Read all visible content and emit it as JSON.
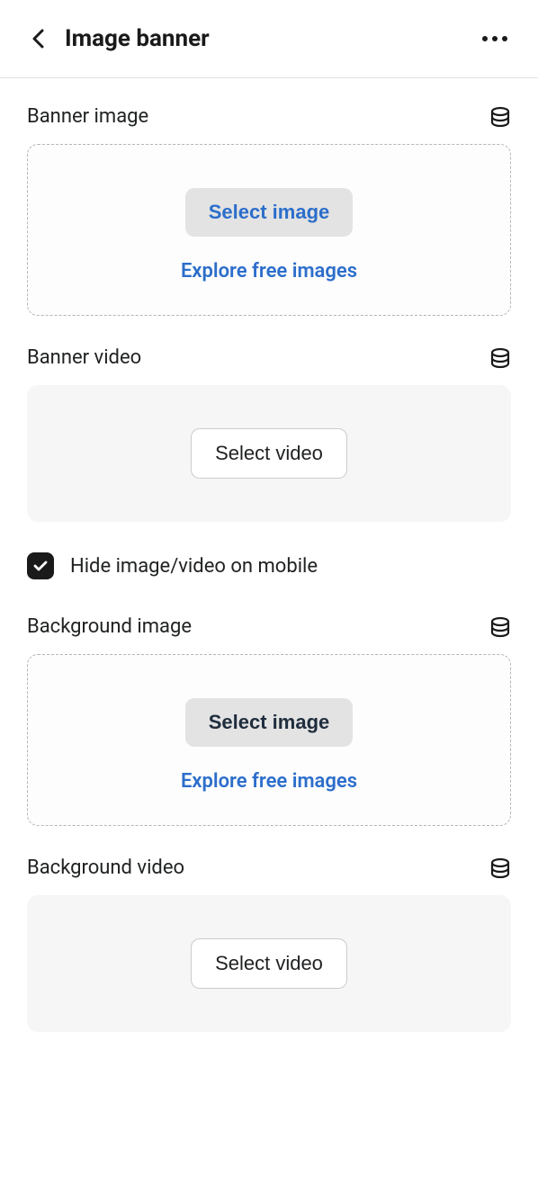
{
  "header": {
    "title": "Image banner"
  },
  "sections": {
    "banner_image": {
      "label": "Banner image",
      "select_btn": "Select image",
      "explore_link": "Explore free images"
    },
    "banner_video": {
      "label": "Banner video",
      "select_btn": "Select video"
    },
    "hide_mobile": {
      "checked": true,
      "label": "Hide image/video on mobile"
    },
    "background_image": {
      "label": "Background image",
      "select_btn": "Select image",
      "explore_link": "Explore free images"
    },
    "background_video": {
      "label": "Background video",
      "select_btn": "Select video"
    }
  }
}
